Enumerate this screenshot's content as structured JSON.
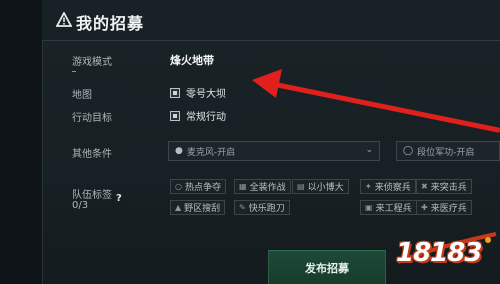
{
  "window": {
    "title": "我的招募"
  },
  "form": {
    "mode": {
      "label": "游戏模式",
      "value": "烽火地带"
    },
    "map": {
      "label": "地图",
      "option": "零号大坝"
    },
    "objective": {
      "label": "行动目标",
      "option": "常规行动"
    },
    "other": {
      "label": "其他条件",
      "mic_dropdown": {
        "icon": "microphone-icon",
        "value": "麦克风-开启"
      },
      "rank_dropdown": {
        "icon": "shield-icon",
        "value": "段位军功-开启"
      }
    },
    "team_tags": {
      "label": "队伍标签",
      "count": "0/3",
      "help": "?",
      "tags": [
        {
          "label": "热点争夺"
        },
        {
          "label": "全装作战"
        },
        {
          "label": "以小博大"
        },
        {
          "label": "来侦察兵"
        },
        {
          "label": "来突击兵"
        },
        {
          "label": "野区搜刮"
        },
        {
          "label": "快乐跑刀"
        },
        {
          "label": "来工程兵"
        },
        {
          "label": "来医疗兵"
        }
      ]
    }
  },
  "actions": {
    "publish_label": "发布招募"
  },
  "watermark": {
    "text": "18183"
  },
  "colors": {
    "accent_green": "#1e4a36",
    "arrow_red": "#e0201c"
  }
}
